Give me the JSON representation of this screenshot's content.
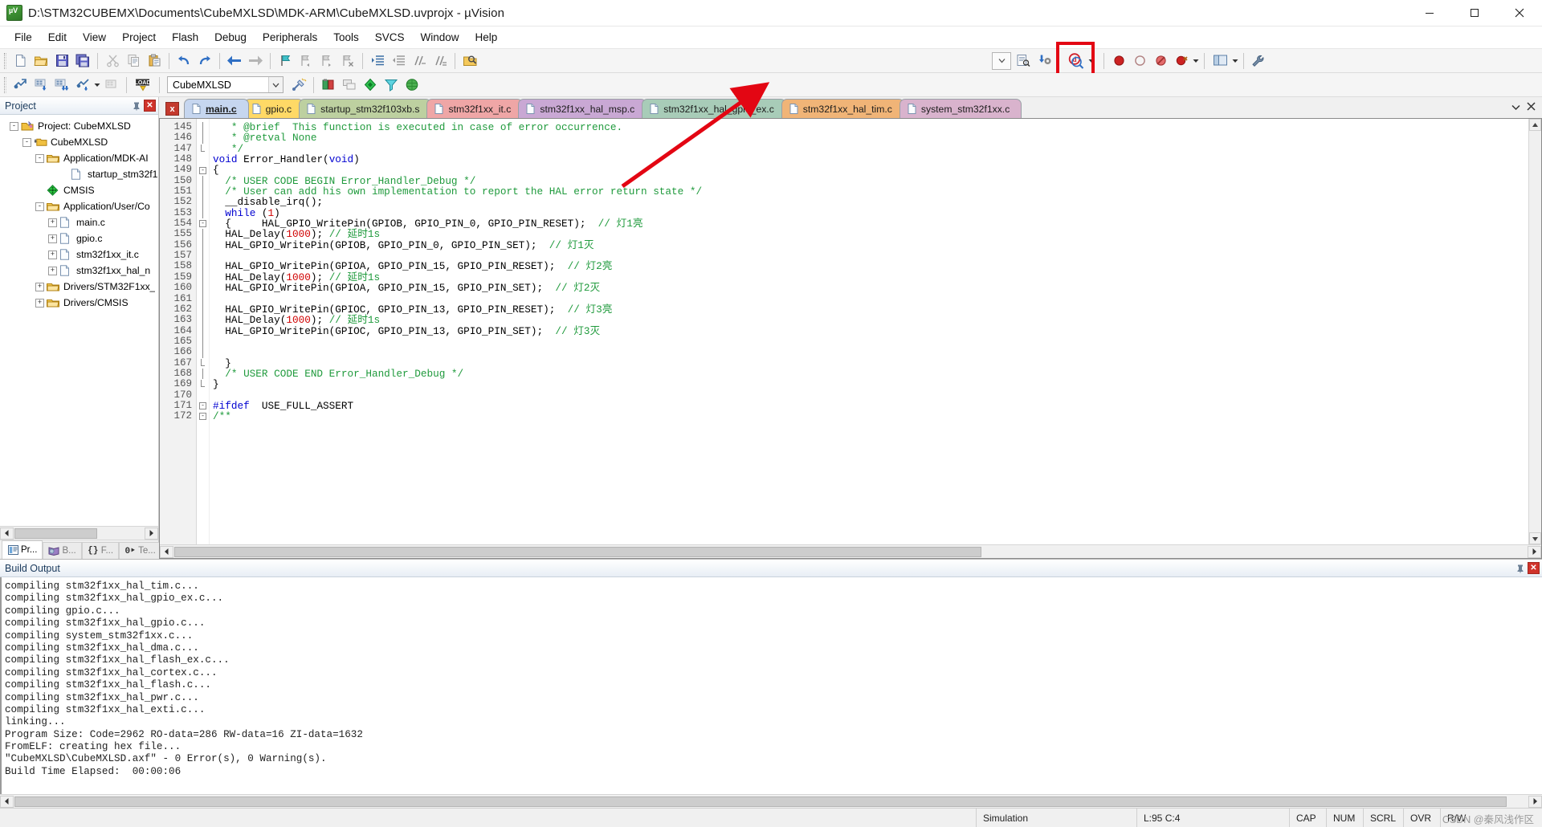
{
  "window": {
    "title": "D:\\STM32CUBEMX\\Documents\\CubeMXLSD\\MDK-ARM\\CubeMXLSD.uvprojx - µVision",
    "app_icon": "uvision-icon",
    "minimize_label": "─",
    "maximize_label": "□",
    "close_label": "✕"
  },
  "menu": {
    "items": [
      {
        "label": "File"
      },
      {
        "label": "Edit"
      },
      {
        "label": "View"
      },
      {
        "label": "Project"
      },
      {
        "label": "Flash"
      },
      {
        "label": "Debug"
      },
      {
        "label": "Peripherals"
      },
      {
        "label": "Tools"
      },
      {
        "label": "SVCS"
      },
      {
        "label": "Window"
      },
      {
        "label": "Help"
      }
    ]
  },
  "toolbar_main": {
    "buttons": [
      {
        "name": "new-file-icon",
        "tip": "New"
      },
      {
        "name": "open-file-icon",
        "tip": "Open"
      },
      {
        "name": "save-icon",
        "tip": "Save"
      },
      {
        "name": "save-all-icon",
        "tip": "Save All"
      },
      {
        "name": "cut-icon",
        "tip": "Cut"
      },
      {
        "name": "copy-icon",
        "tip": "Copy"
      },
      {
        "name": "paste-icon",
        "tip": "Paste"
      },
      {
        "name": "undo-icon",
        "tip": "Undo"
      },
      {
        "name": "redo-icon",
        "tip": "Redo"
      },
      {
        "name": "navigate-back-icon",
        "tip": "Back"
      },
      {
        "name": "navigate-forward-icon",
        "tip": "Forward"
      },
      {
        "name": "bookmark-toggle-icon",
        "tip": "Insert/Remove Bookmark"
      },
      {
        "name": "bookmark-prev-icon",
        "tip": "Previous Bookmark"
      },
      {
        "name": "bookmark-next-icon",
        "tip": "Next Bookmark"
      },
      {
        "name": "bookmark-clear-icon",
        "tip": "Clear All Bookmarks"
      },
      {
        "name": "indent-icon",
        "tip": "Indent"
      },
      {
        "name": "outdent-icon",
        "tip": "Outdent"
      },
      {
        "name": "comment-icon",
        "tip": "Comment"
      },
      {
        "name": "uncomment-icon",
        "tip": "Uncomment"
      },
      {
        "name": "find-in-files-icon",
        "tip": "Find in Files"
      }
    ],
    "search_box_value": "",
    "right_buttons": [
      {
        "name": "search-list-icon",
        "tip": "Find"
      },
      {
        "name": "configure-icon",
        "tip": "Configure"
      },
      {
        "name": "start-debug-icon",
        "tip": "Start/Stop Debug Session"
      },
      {
        "name": "insert-breakpoint-icon",
        "tip": "Insert/Remove Breakpoint"
      },
      {
        "name": "disable-breakpoint-icon",
        "tip": "Enable/Disable Breakpoint"
      },
      {
        "name": "disable-all-breakpoints-icon",
        "tip": "Disable All Breakpoints"
      },
      {
        "name": "kill-all-breakpoints-icon",
        "tip": "Kill All Breakpoints"
      },
      {
        "name": "window-layout-icon",
        "tip": "Manage Window Layout"
      },
      {
        "name": "settings-wrench-icon",
        "tip": "Configuration Wizard"
      }
    ]
  },
  "toolbar_build": {
    "buttons": [
      {
        "name": "translate-icon",
        "tip": "Translate"
      },
      {
        "name": "build-icon",
        "tip": "Build"
      },
      {
        "name": "rebuild-icon",
        "tip": "Rebuild"
      },
      {
        "name": "batch-build-icon",
        "tip": "Batch Build"
      },
      {
        "name": "stop-build-icon",
        "tip": "Stop Build"
      },
      {
        "name": "download-icon",
        "tip": "Download"
      }
    ],
    "target_value": "CubeMXLSD",
    "right_buttons": [
      {
        "name": "target-options-icon",
        "tip": "Options for Target"
      },
      {
        "name": "manage-project-items-icon",
        "tip": "Manage Project Items"
      },
      {
        "name": "multi-project-icon",
        "tip": "Multi-Project"
      },
      {
        "name": "pack-installer-icon",
        "tip": "Pack Installer"
      },
      {
        "name": "manage-rte-icon",
        "tip": "Manage Run-Time Environment"
      },
      {
        "name": "select-software-packs-icon",
        "tip": "Select Software Packs"
      }
    ]
  },
  "project_panel": {
    "title": "Project",
    "pin_icon": "pin-icon",
    "close_icon": "close-icon",
    "tree": [
      {
        "label": "Project: CubeMXLSD",
        "depth": 0,
        "expander": "-",
        "icon": "project-icon"
      },
      {
        "label": "CubeMXLSD",
        "depth": 1,
        "expander": "-",
        "icon": "target-folder-icon"
      },
      {
        "label": "Application/MDK-AI",
        "depth": 2,
        "expander": "-",
        "icon": "folder-icon"
      },
      {
        "label": "startup_stm32f1",
        "depth": 3,
        "expander": "",
        "icon": "file-icon"
      },
      {
        "label": "CMSIS",
        "depth": 2,
        "expander": "",
        "icon": "cmsis-icon"
      },
      {
        "label": "Application/User/Co",
        "depth": 2,
        "expander": "-",
        "icon": "folder-icon"
      },
      {
        "label": "main.c",
        "depth": 3,
        "expander": "+",
        "icon": "file-icon"
      },
      {
        "label": "gpio.c",
        "depth": 3,
        "expander": "+",
        "icon": "file-icon"
      },
      {
        "label": "stm32f1xx_it.c",
        "depth": 3,
        "expander": "+",
        "icon": "file-icon"
      },
      {
        "label": "stm32f1xx_hal_n",
        "depth": 3,
        "expander": "+",
        "icon": "file-icon"
      },
      {
        "label": "Drivers/STM32F1xx_",
        "depth": 2,
        "expander": "+",
        "icon": "folder-icon"
      },
      {
        "label": "Drivers/CMSIS",
        "depth": 2,
        "expander": "+",
        "icon": "folder-icon"
      }
    ],
    "bottom_tabs": [
      {
        "label": "Pr...",
        "icon": "project-tab-icon",
        "active": true
      },
      {
        "label": "B...",
        "icon": "books-tab-icon",
        "active": false
      },
      {
        "label": "F...",
        "icon": "functions-tab-icon",
        "active": false
      },
      {
        "label": "Te...",
        "icon": "templates-tab-icon",
        "active": false
      }
    ]
  },
  "editor": {
    "tab_close_label": "x",
    "tabs": [
      {
        "label": "main.c",
        "color": "#c6d6ef",
        "active": true
      },
      {
        "label": "gpio.c",
        "color": "#ffd966",
        "active": false
      },
      {
        "label": "startup_stm32f103xb.s",
        "color": "#bdd0a0",
        "active": false
      },
      {
        "label": "stm32f1xx_it.c",
        "color": "#efa6a6",
        "active": false
      },
      {
        "label": "stm32f1xx_hal_msp.c",
        "color": "#c9a8d4",
        "active": false
      },
      {
        "label": "stm32f1xx_hal_gpio_ex.c",
        "color": "#a8ccb8",
        "active": false
      },
      {
        "label": "stm32f1xx_hal_tim.c",
        "color": "#f0b477",
        "active": false
      },
      {
        "label": "system_stm32f1xx.c",
        "color": "#d9b3cd",
        "active": false
      }
    ],
    "tabstrip_menu_icon": "chevron-down-icon",
    "tabstrip_close_icon": "close-icon",
    "first_line_number": 145,
    "lines": [
      {
        "n": 145,
        "fold": "line",
        "parts": [
          {
            "t": "   * @brief  This function is executed in case of error occurrence.",
            "c": "cm"
          }
        ]
      },
      {
        "n": 146,
        "fold": "line",
        "parts": [
          {
            "t": "   * @retval None",
            "c": "cm"
          }
        ]
      },
      {
        "n": 147,
        "fold": "end",
        "parts": [
          {
            "t": "   */",
            "c": "cm"
          }
        ]
      },
      {
        "n": 148,
        "fold": "",
        "parts": [
          {
            "t": "void",
            "c": "kw"
          },
          {
            "t": " Error_Handler(",
            "c": ""
          },
          {
            "t": "void",
            "c": "kw"
          },
          {
            "t": ")",
            "c": ""
          }
        ]
      },
      {
        "n": 149,
        "fold": "box",
        "parts": [
          {
            "t": "{",
            "c": ""
          }
        ]
      },
      {
        "n": 150,
        "fold": "line",
        "parts": [
          {
            "t": "  /* USER CODE BEGIN Error_Handler_Debug */",
            "c": "cm"
          }
        ]
      },
      {
        "n": 151,
        "fold": "line",
        "parts": [
          {
            "t": "  /* User can add his own implementation to report the HAL error return state */",
            "c": "cm"
          }
        ]
      },
      {
        "n": 152,
        "fold": "line",
        "parts": [
          {
            "t": "  __disable_irq();",
            "c": ""
          }
        ]
      },
      {
        "n": 153,
        "fold": "line",
        "parts": [
          {
            "t": "  ",
            "c": ""
          },
          {
            "t": "while",
            "c": "kw"
          },
          {
            "t": " (",
            "c": ""
          },
          {
            "t": "1",
            "c": "num"
          },
          {
            "t": ")",
            "c": ""
          }
        ]
      },
      {
        "n": 154,
        "fold": "box",
        "parts": [
          {
            "t": "  {     HAL_GPIO_WritePin(GPIOB, GPIO_PIN_0, GPIO_PIN_RESET);  ",
            "c": ""
          },
          {
            "t": "// 灯1亮",
            "c": "cm"
          }
        ]
      },
      {
        "n": 155,
        "fold": "line",
        "parts": [
          {
            "t": "  HAL_Delay(",
            "c": ""
          },
          {
            "t": "1000",
            "c": "num"
          },
          {
            "t": "); ",
            "c": ""
          },
          {
            "t": "// 延时1s",
            "c": "cm"
          }
        ]
      },
      {
        "n": 156,
        "fold": "line",
        "parts": [
          {
            "t": "  HAL_GPIO_WritePin(GPIOB, GPIO_PIN_0, GPIO_PIN_SET);  ",
            "c": ""
          },
          {
            "t": "// 灯1灭",
            "c": "cm"
          }
        ]
      },
      {
        "n": 157,
        "fold": "line",
        "parts": [
          {
            "t": "",
            "c": ""
          }
        ]
      },
      {
        "n": 158,
        "fold": "line",
        "parts": [
          {
            "t": "  HAL_GPIO_WritePin(GPIOA, GPIO_PIN_15, GPIO_PIN_RESET);  ",
            "c": ""
          },
          {
            "t": "// 灯2亮",
            "c": "cm"
          }
        ]
      },
      {
        "n": 159,
        "fold": "line",
        "parts": [
          {
            "t": "  HAL_Delay(",
            "c": ""
          },
          {
            "t": "1000",
            "c": "num"
          },
          {
            "t": "); ",
            "c": ""
          },
          {
            "t": "// 延时1s",
            "c": "cm"
          }
        ]
      },
      {
        "n": 160,
        "fold": "line",
        "parts": [
          {
            "t": "  HAL_GPIO_WritePin(GPIOA, GPIO_PIN_15, GPIO_PIN_SET);  ",
            "c": ""
          },
          {
            "t": "// 灯2灭",
            "c": "cm"
          }
        ]
      },
      {
        "n": 161,
        "fold": "line",
        "parts": [
          {
            "t": "",
            "c": ""
          }
        ]
      },
      {
        "n": 162,
        "fold": "line",
        "parts": [
          {
            "t": "  HAL_GPIO_WritePin(GPIOC, GPIO_PIN_13, GPIO_PIN_RESET);  ",
            "c": ""
          },
          {
            "t": "// 灯3亮",
            "c": "cm"
          }
        ]
      },
      {
        "n": 163,
        "fold": "line",
        "parts": [
          {
            "t": "  HAL_Delay(",
            "c": ""
          },
          {
            "t": "1000",
            "c": "num"
          },
          {
            "t": "); ",
            "c": ""
          },
          {
            "t": "// 延时1s",
            "c": "cm"
          }
        ]
      },
      {
        "n": 164,
        "fold": "line",
        "parts": [
          {
            "t": "  HAL_GPIO_WritePin(GPIOC, GPIO_PIN_13, GPIO_PIN_SET);  ",
            "c": ""
          },
          {
            "t": "// 灯3灭",
            "c": "cm"
          }
        ]
      },
      {
        "n": 165,
        "fold": "line",
        "parts": [
          {
            "t": "",
            "c": ""
          }
        ]
      },
      {
        "n": 166,
        "fold": "line",
        "parts": [
          {
            "t": "",
            "c": ""
          }
        ]
      },
      {
        "n": 167,
        "fold": "end",
        "parts": [
          {
            "t": "  }",
            "c": ""
          }
        ]
      },
      {
        "n": 168,
        "fold": "line",
        "parts": [
          {
            "t": "  /* USER CODE END Error_Handler_Debug */",
            "c": "cm"
          }
        ]
      },
      {
        "n": 169,
        "fold": "end",
        "parts": [
          {
            "t": "}",
            "c": ""
          }
        ]
      },
      {
        "n": 170,
        "fold": "",
        "parts": [
          {
            "t": "",
            "c": ""
          }
        ]
      },
      {
        "n": 171,
        "fold": "box",
        "parts": [
          {
            "t": "#ifdef",
            "c": "pp"
          },
          {
            "t": "  USE_FULL_ASSERT",
            "c": ""
          }
        ]
      },
      {
        "n": 172,
        "fold": "box",
        "parts": [
          {
            "t": "/**",
            "c": "cm"
          }
        ]
      }
    ]
  },
  "build_output": {
    "title": "Build Output",
    "pin_icon": "pin-icon",
    "close_icon": "close-icon",
    "lines": [
      "compiling stm32f1xx_hal_tim.c...",
      "compiling stm32f1xx_hal_gpio_ex.c...",
      "compiling gpio.c...",
      "compiling stm32f1xx_hal_gpio.c...",
      "compiling system_stm32f1xx.c...",
      "compiling stm32f1xx_hal_dma.c...",
      "compiling stm32f1xx_hal_flash_ex.c...",
      "compiling stm32f1xx_hal_cortex.c...",
      "compiling stm32f1xx_hal_flash.c...",
      "compiling stm32f1xx_hal_pwr.c...",
      "compiling stm32f1xx_hal_exti.c...",
      "linking...",
      "Program Size: Code=2962 RO-data=286 RW-data=16 ZI-data=1632",
      "FromELF: creating hex file...",
      "\"CubeMXLSD\\CubeMXLSD.axf\" - 0 Error(s), 0 Warning(s).",
      "Build Time Elapsed:  00:00:06"
    ]
  },
  "statusbar": {
    "left_text": "",
    "simulation": "Simulation",
    "cursor": "L:95 C:4",
    "caps": "CAP",
    "num": "NUM",
    "scrl": "SCRL",
    "ovr": "OVR",
    "rw": "R/W",
    "watermark": "CSDN @秦风浅作区"
  },
  "annotation": {
    "arrow_color": "#e30613",
    "highlight_color": "#e30613"
  }
}
